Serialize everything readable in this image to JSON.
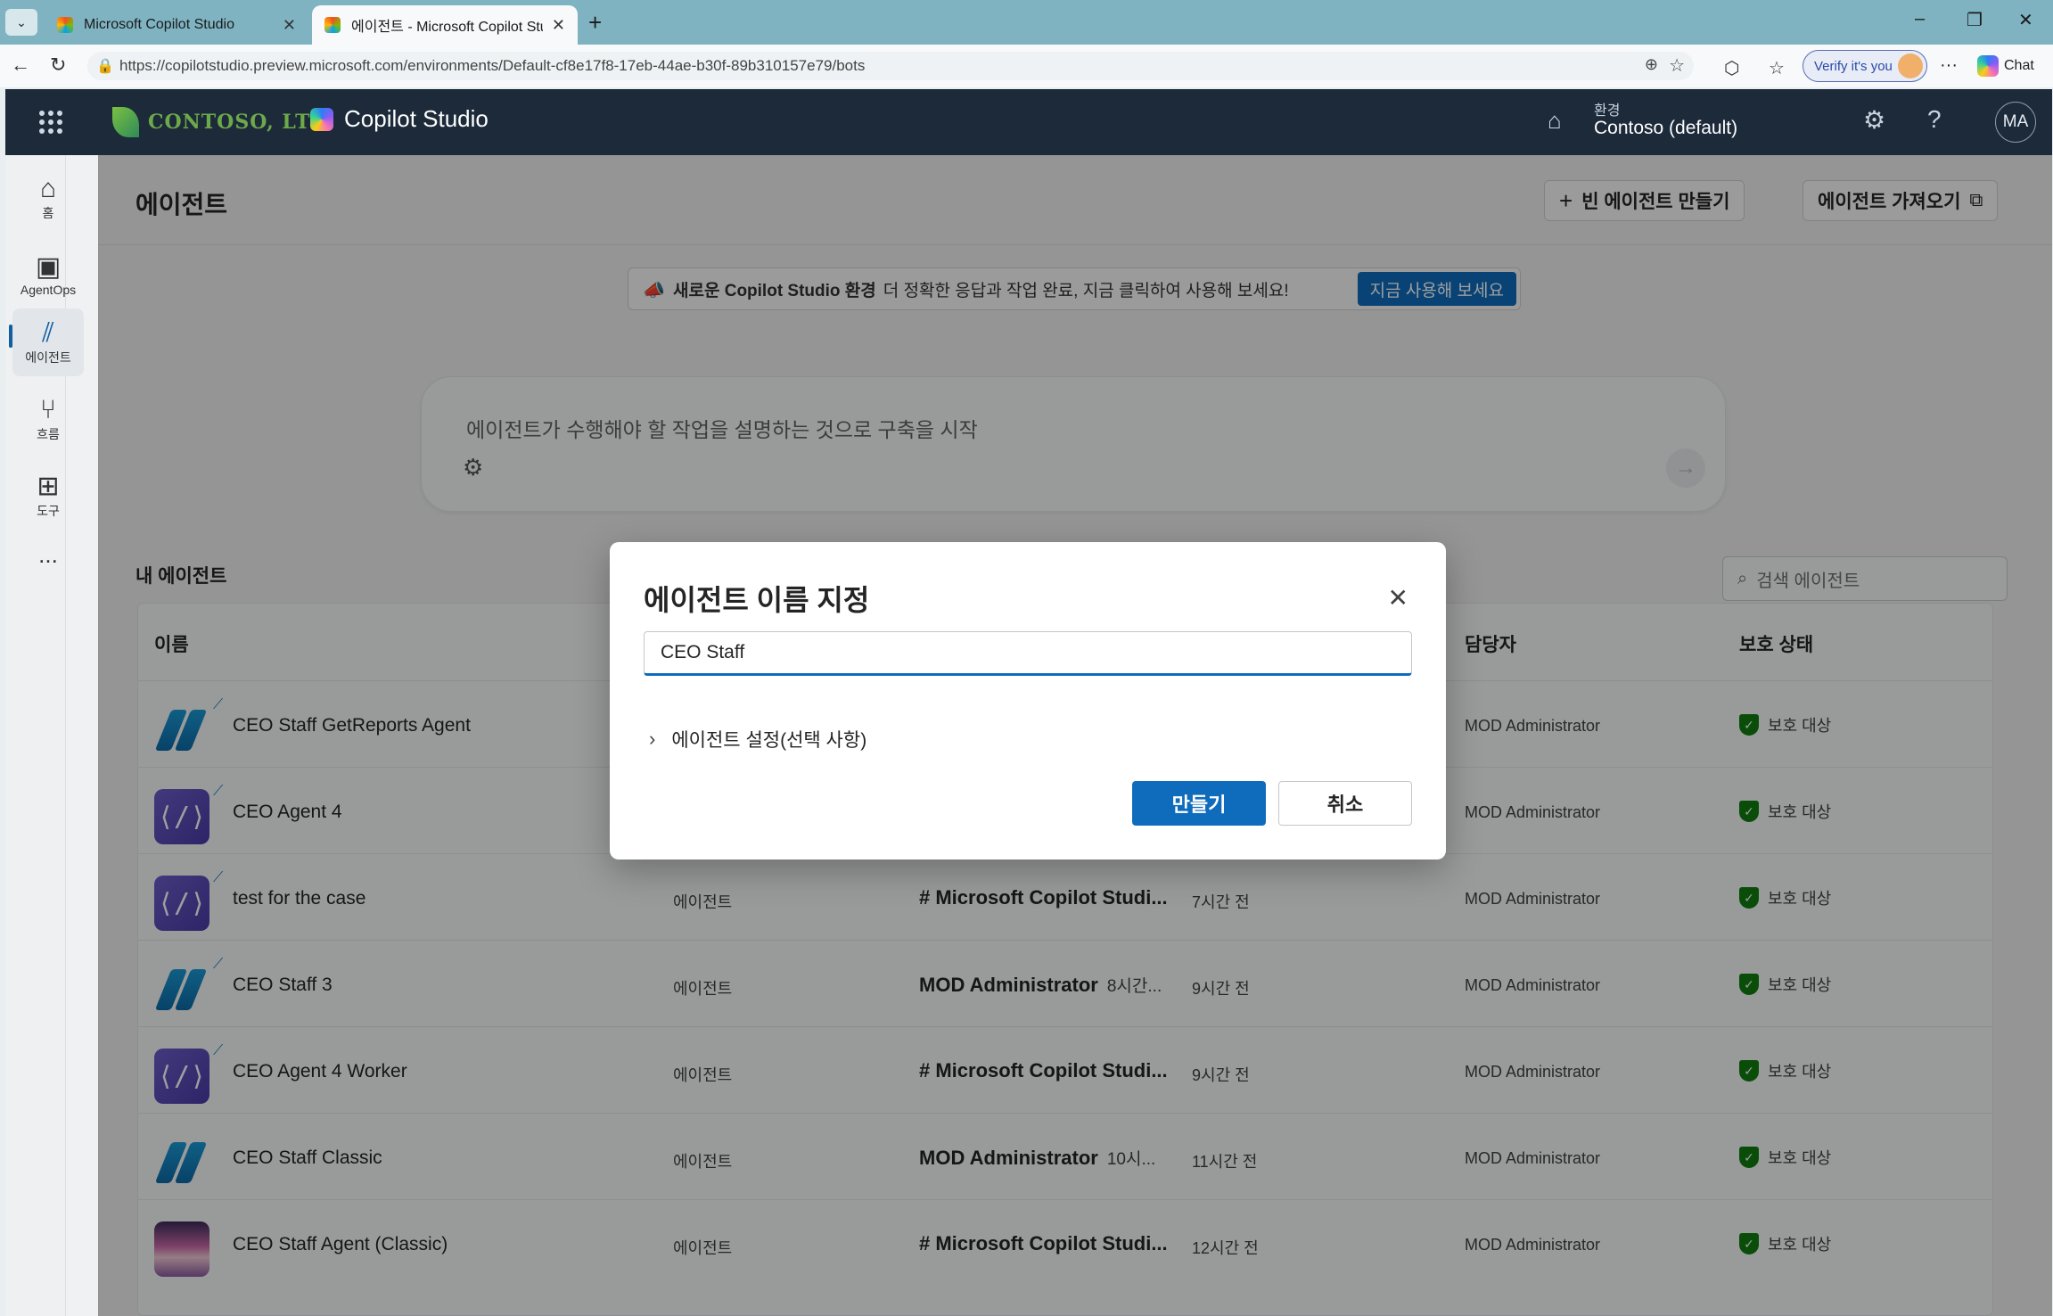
{
  "browser": {
    "tabs": [
      {
        "title": "Microsoft Copilot Studio",
        "active": false
      },
      {
        "title": "에이전트 - Microsoft Copilot Studio",
        "active": true
      }
    ],
    "url": "https://copilotstudio.preview.microsoft.com/environments/Default-cf8e17f8-17eb-44ae-b30f-89b310157e79/bots",
    "verify_label": "Verify it's you",
    "chat_label": "Chat"
  },
  "header": {
    "org_name": "CONTOSO, LTD.",
    "product_name": "Copilot Studio",
    "env_label": "환경",
    "env_value": "Contoso (default)",
    "avatar_initials": "MA"
  },
  "rail": {
    "items": [
      {
        "label": "홈",
        "icon": "home-icon"
      },
      {
        "label": "AgentOps",
        "icon": "agentops-icon"
      },
      {
        "label": "에이전트",
        "icon": "agents-icon",
        "selected": true
      },
      {
        "label": "흐름",
        "icon": "flow-icon"
      },
      {
        "label": "도구",
        "icon": "tools-icon"
      }
    ],
    "more": "..."
  },
  "page": {
    "title": "에이전트",
    "new_agent_label": "빈 에이전트 만들기",
    "import_agent_label": "에이전트 가져오기"
  },
  "banner": {
    "bold": "새로운 Copilot Studio 환경",
    "text": "더 정확한 응답과 작업 완료, 지금 클릭하여 사용해 보세요!",
    "button": "지금 사용해 보세요"
  },
  "prompt": {
    "placeholder": "에이전트가 수행해야 할 작업을 설명하는 것으로 구축을 시작"
  },
  "my_agents": {
    "title": "내 에이전트",
    "search_placeholder": "검색 에이전트",
    "columns": {
      "name": "이름",
      "owner_col": "담당자",
      "protection": "보호 상태"
    },
    "rows": [
      {
        "name": "CEO Staff GetReports Agent",
        "avatar": "slash",
        "new": true,
        "type": "",
        "owner": "",
        "owner_sub": "",
        "modified": "",
        "admin": "MOD Administrator",
        "protection": "보호 대상"
      },
      {
        "name": "CEO Agent 4",
        "avatar": "code",
        "new": true,
        "type": "",
        "owner": "",
        "owner_sub": "",
        "modified": "",
        "admin": "MOD Administrator",
        "protection": "보호 대상"
      },
      {
        "name": "test for the case",
        "avatar": "code",
        "new": true,
        "type": "에이전트",
        "owner": "# Microsoft Copilot Studi...",
        "owner_sub": "",
        "modified": "7시간 전",
        "admin": "MOD Administrator",
        "protection": "보호 대상"
      },
      {
        "name": "CEO Staff 3",
        "avatar": "slash",
        "new": true,
        "type": "에이전트",
        "owner": "MOD Administrator",
        "owner_sub": "8시간...",
        "modified": "9시간 전",
        "admin": "MOD Administrator",
        "protection": "보호 대상"
      },
      {
        "name": "CEO Agent 4 Worker",
        "avatar": "code",
        "new": true,
        "type": "에이전트",
        "owner": "# Microsoft Copilot Studi...",
        "owner_sub": "",
        "modified": "9시간 전",
        "admin": "MOD Administrator",
        "protection": "보호 대상"
      },
      {
        "name": "CEO Staff Classic",
        "avatar": "slash",
        "new": false,
        "type": "에이전트",
        "owner": "MOD Administrator",
        "owner_sub": "10시...",
        "modified": "11시간 전",
        "admin": "MOD Administrator",
        "protection": "보호 대상"
      },
      {
        "name": "CEO Staff Agent (Classic)",
        "avatar": "photo",
        "new": false,
        "type": "에이전트",
        "owner": "# Microsoft Copilot Studi...",
        "owner_sub": "",
        "modified": "12시간 전",
        "admin": "MOD Administrator",
        "protection": "보호 대상"
      }
    ]
  },
  "dialog": {
    "title": "에이전트 이름 지정",
    "input_value": "CEO Staff",
    "expander_label": "에이전트 설정(선택 사항)",
    "create_label": "만들기",
    "cancel_label": "취소"
  },
  "colors": {
    "accent": "#0f6cbd",
    "header_bg": "#1c2a3a",
    "shield": "#107c10"
  }
}
